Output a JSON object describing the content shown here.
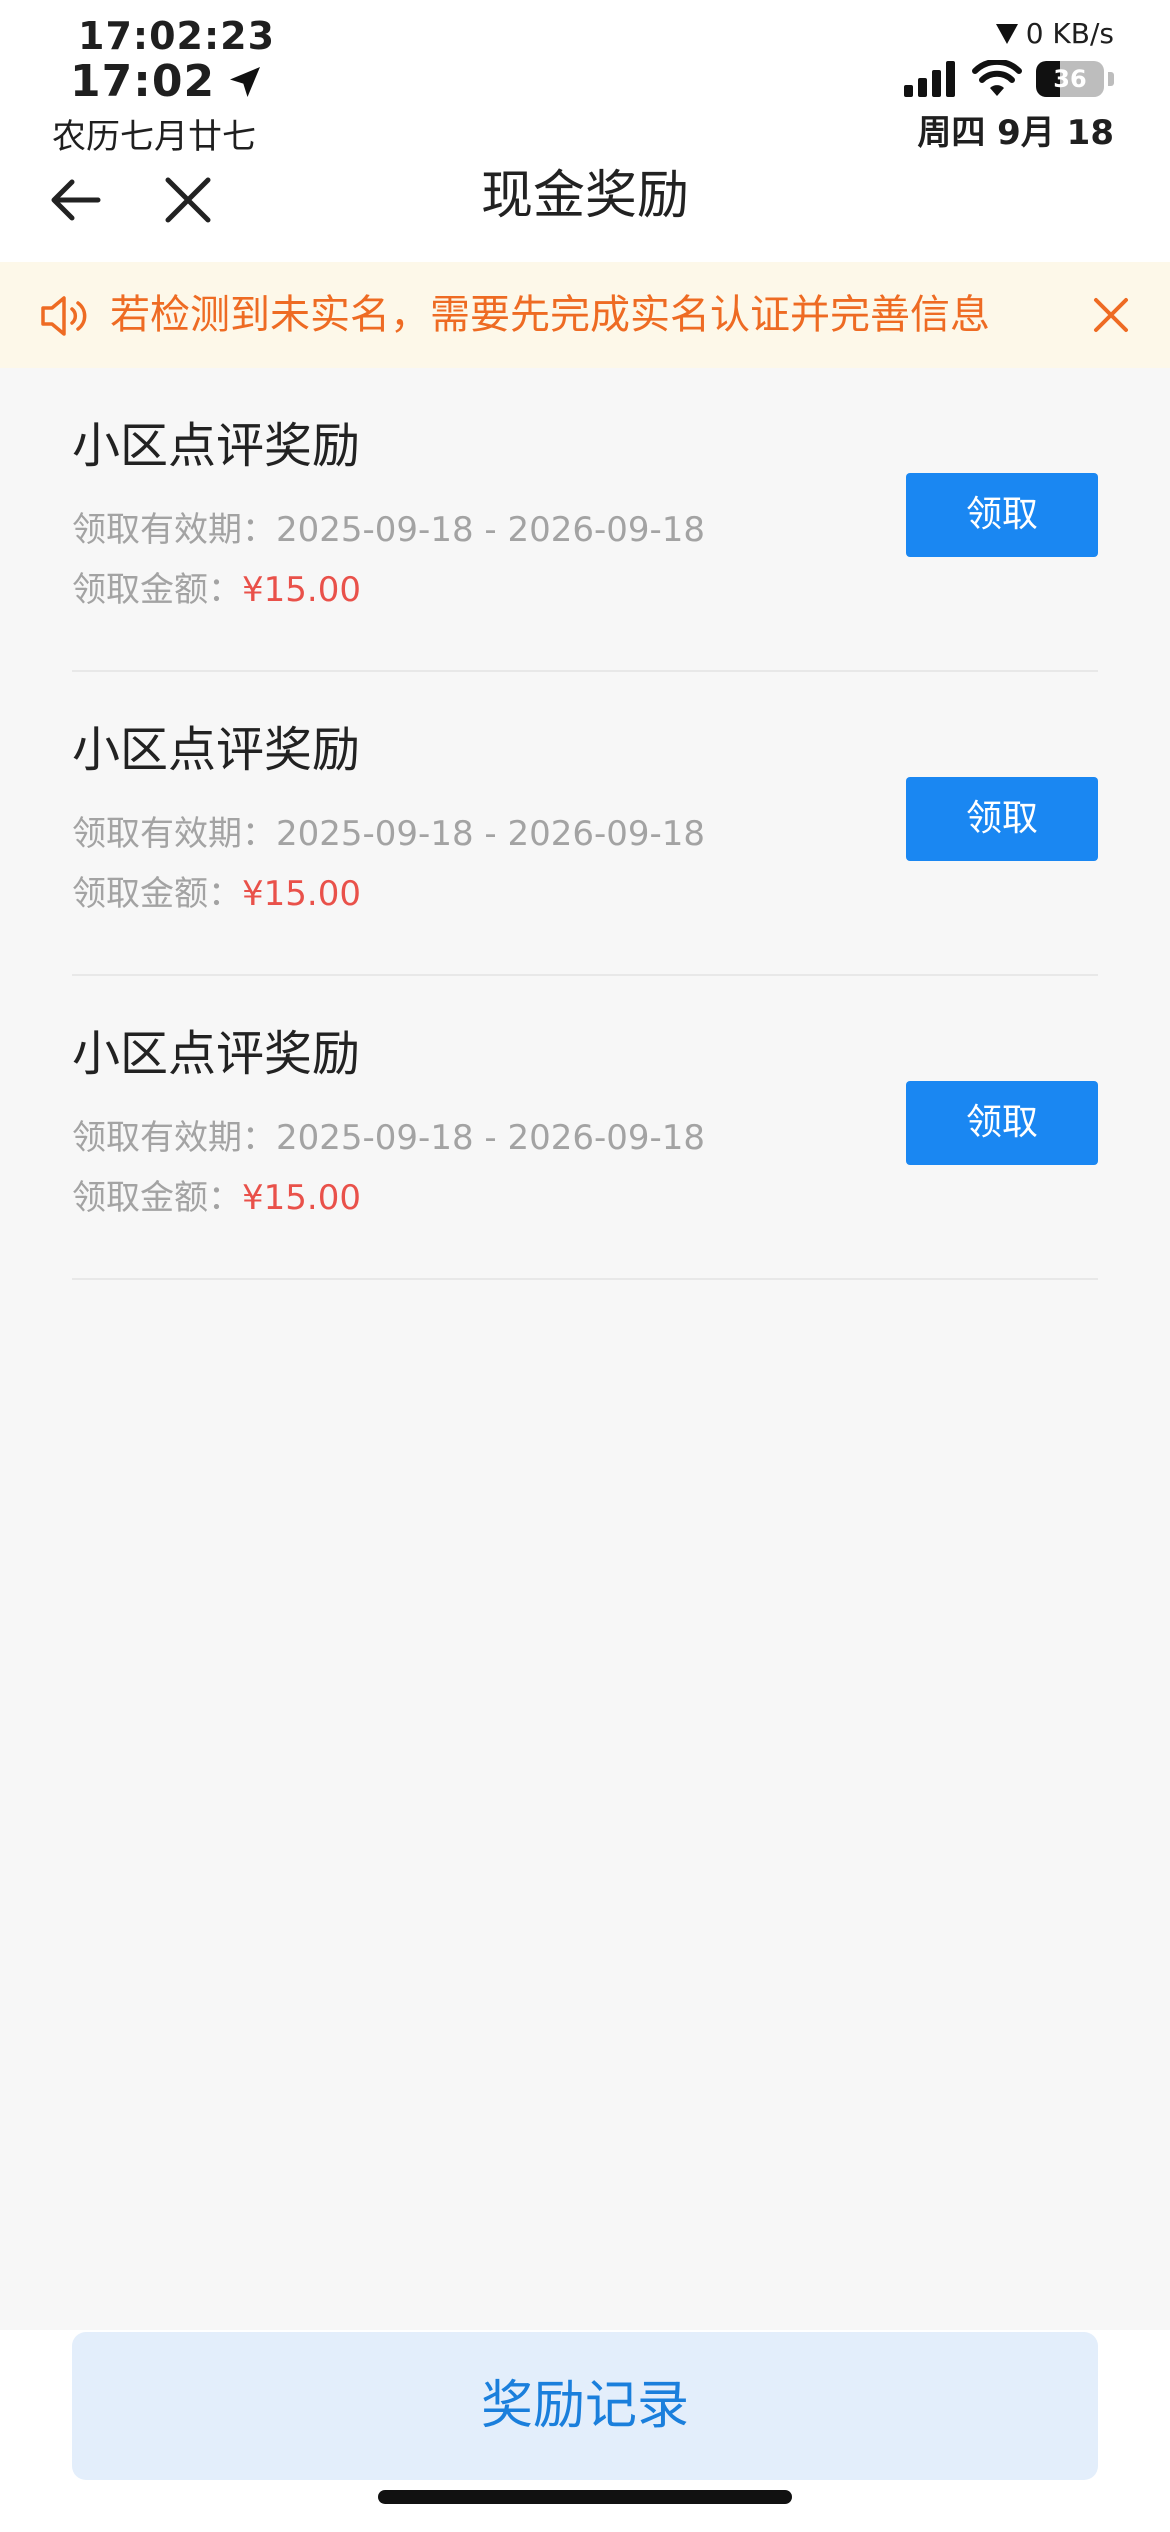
{
  "status_bar": {
    "seconds_time": "17:02:23",
    "time": "17:02",
    "lunar_date": "农历七月廿七",
    "network_speed": "0 KB/s",
    "battery_level": "36",
    "date": "周四 9月 18"
  },
  "nav": {
    "title": "现金奖励"
  },
  "notice": {
    "text": "若检测到未实名，需要先完成实名认证并完善信息",
    "color": "#ee6b23",
    "background": "#fdf8e9"
  },
  "rewards": [
    {
      "title": "小区点评奖励",
      "period_label": "领取有效期：",
      "period_value": "2025-09-18 - 2026-09-18",
      "amount_label": "领取金额：",
      "amount_value": "¥15.00",
      "button_label": "领取"
    },
    {
      "title": "小区点评奖励",
      "period_label": "领取有效期：",
      "period_value": "2025-09-18 - 2026-09-18",
      "amount_label": "领取金额：",
      "amount_value": "¥15.00",
      "button_label": "领取"
    },
    {
      "title": "小区点评奖励",
      "period_label": "领取有效期：",
      "period_value": "2025-09-18 - 2026-09-18",
      "amount_label": "领取金额：",
      "amount_value": "¥15.00",
      "button_label": "领取"
    }
  ],
  "footer": {
    "records_button_label": "奖励记录"
  },
  "colors": {
    "primary": "#1a87f2",
    "amount": "#e9514a",
    "records_button_bg": "#e3eefb"
  }
}
